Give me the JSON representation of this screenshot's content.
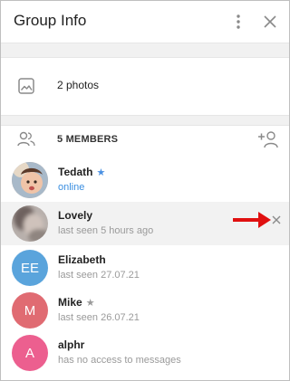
{
  "header": {
    "title": "Group Info"
  },
  "photos": {
    "label": "2 photos"
  },
  "members_section": {
    "label": "5 MEMBERS"
  },
  "members": [
    {
      "name": "Tedath",
      "status": "online",
      "badge": "★",
      "badge_color": "#4a90e2",
      "avatar_type": "photo"
    },
    {
      "name": "Lovely",
      "status": "last seen 5 hours ago",
      "avatar_type": "photo-blurred"
    },
    {
      "name": "Elizabeth",
      "status": "last seen 27.07.21",
      "initials": "EE",
      "avatar_color": "#5aa4dc"
    },
    {
      "name": "Mike",
      "status": "last seen 26.07.21",
      "badge": "★",
      "badge_color": "#9a9a9a",
      "initials": "M",
      "avatar_color": "#e06b72"
    },
    {
      "name": "alphr",
      "status": "has no access to messages",
      "initials": "A",
      "avatar_color": "#ec5f8f"
    }
  ],
  "colors": {
    "accent": "#3a8ee0",
    "arrow": "#e01010",
    "hover_row": "#f2f2f2"
  },
  "icons": [
    "more-vert-icon",
    "close-icon",
    "photo-icon",
    "people-icon",
    "add-user-icon",
    "remove-icon",
    "arrow-icon"
  ]
}
